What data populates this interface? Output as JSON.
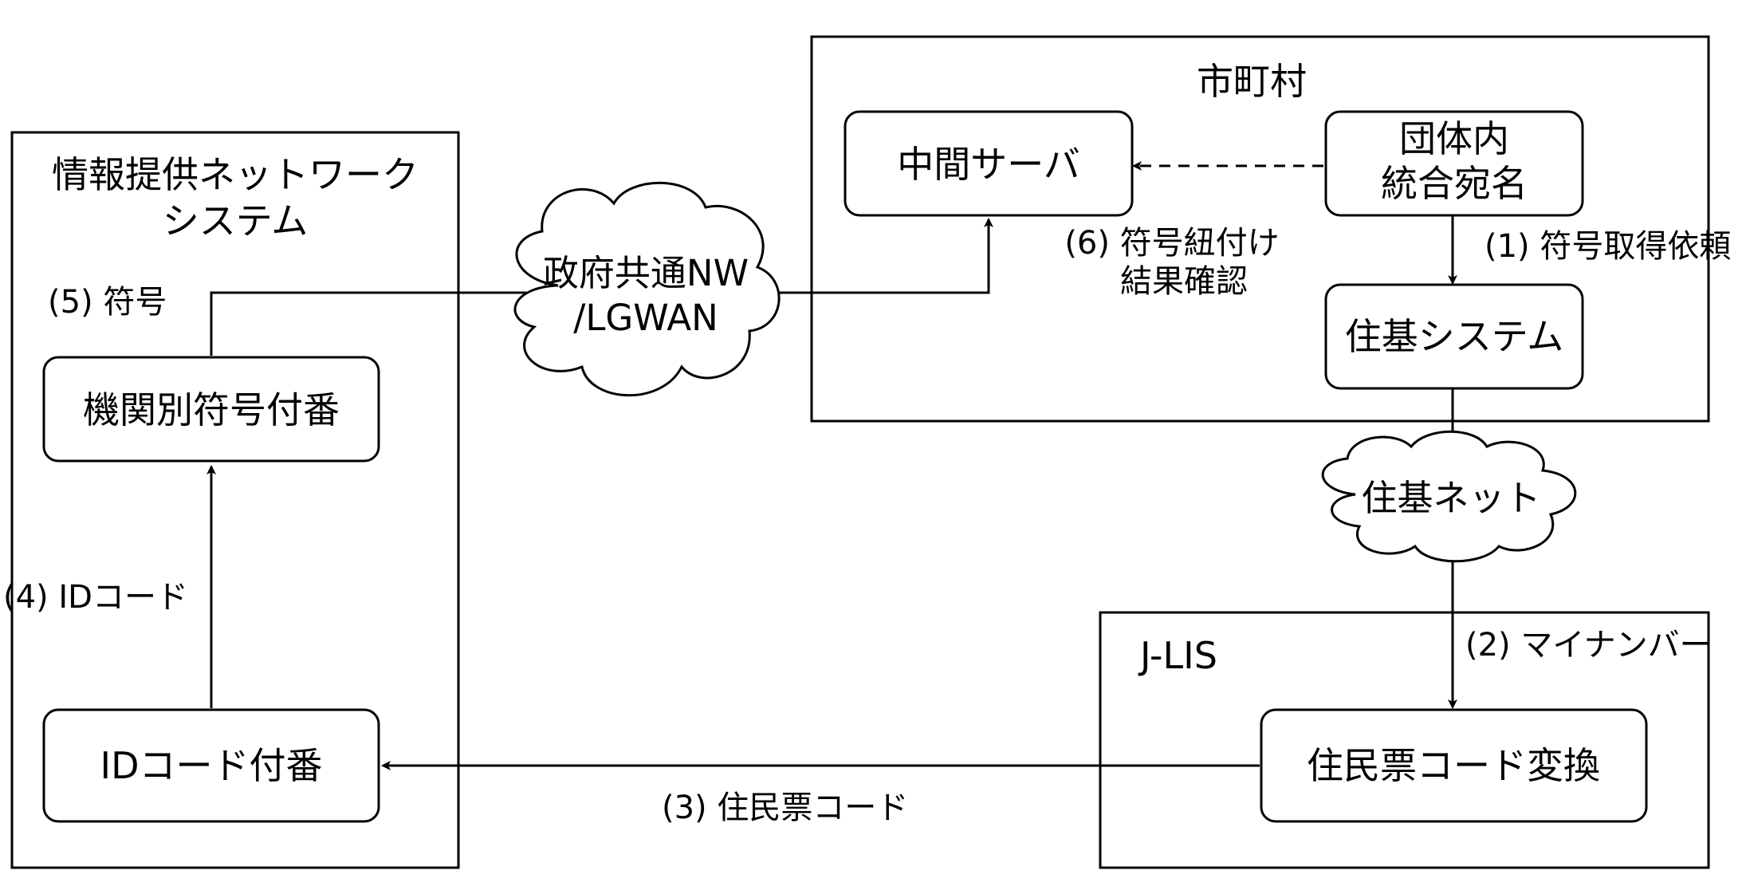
{
  "containers": {
    "network_system_line1": "情報提供ネットワーク",
    "network_system_line2": "システム",
    "municipality": "市町村",
    "jlis": "J-LIS"
  },
  "nodes": {
    "agency_code_numbering": "機関別符号付番",
    "id_code_numbering": "IDコード付番",
    "intermediate_server": "中間サーバ",
    "integrated_address_line1": "団体内",
    "integrated_address_line2": "統合宛名",
    "juki_system": "住基システム",
    "resident_code_conversion": "住民票コード変換"
  },
  "clouds": {
    "gov_nw_line1": "政府共通NW",
    "gov_nw_line2": "/LGWAN",
    "juki_net": "住基ネット"
  },
  "edges": {
    "step1": "(1) 符号取得依頼",
    "step2": "(2) マイナンバー",
    "step3": "(3) 住民票コード",
    "step4": "(4) IDコード",
    "step5": "(5) 符号",
    "step6_line1": "(6) 符号紐付け",
    "step6_line2": "結果確認"
  }
}
